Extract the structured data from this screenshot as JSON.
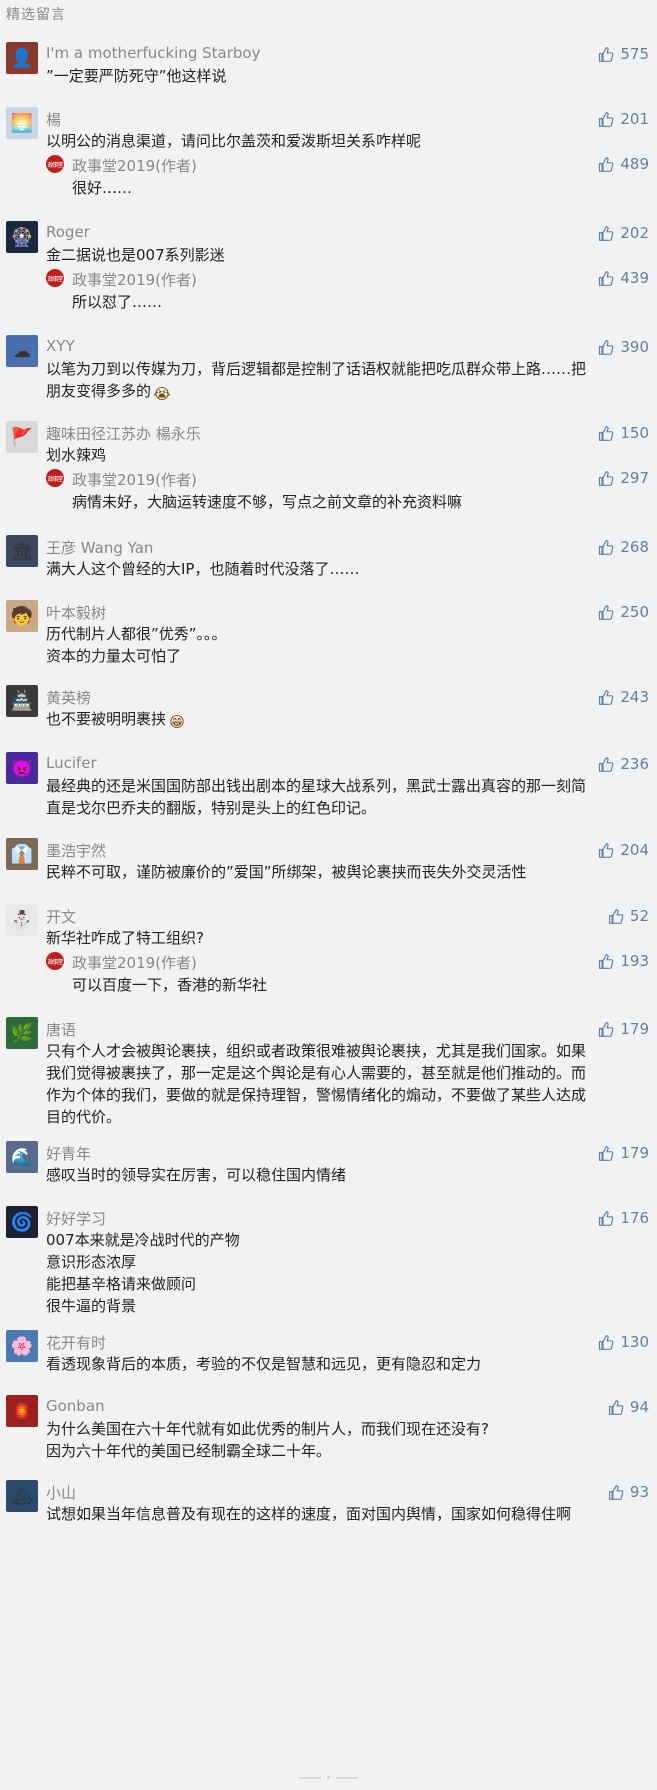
{
  "header": "精选留言",
  "author_badge": "政事堂",
  "comments": [
    {
      "name": "I'm a motherfucking Starboy",
      "likes": "575",
      "lines": [
        "”一定要严防死守”他这样说"
      ]
    },
    {
      "name": "楊",
      "likes": "201",
      "lines": [
        "以明公的消息渠道，请问比尔盖茨和爱泼斯坦关系咋样呢"
      ],
      "reply": {
        "name": "政事堂2019(作者)",
        "likes": "489",
        "lines": [
          "很好……"
        ]
      }
    },
    {
      "name": "Roger",
      "likes": "202",
      "lines": [
        "金二据说也是007系列影迷"
      ],
      "reply": {
        "name": "政事堂2019(作者)",
        "likes": "439",
        "lines": [
          "所以怼了……"
        ]
      }
    },
    {
      "name": "XYY",
      "likes": "390",
      "lines": [
        "以笔为刀到以传媒为刀，背后逻辑都是控制了话语权就能把吃瓜群众带上路……把",
        "朋友变得多多的"
      ],
      "emoji": "😭"
    },
    {
      "name": "趣味田径江苏办 楊永乐",
      "likes": "150",
      "lines": [
        "划水辣鸡"
      ],
      "reply": {
        "name": "政事堂2019(作者)",
        "likes": "297",
        "lines": [
          "病情未好，大脑运转速度不够，写点之前文章的补充资料嘛"
        ]
      }
    },
    {
      "name": "王彦 Wang Yan",
      "likes": "268",
      "lines": [
        "满大人这个曾经的大IP，也随着时代没落了……"
      ]
    },
    {
      "name": "叶本毅树",
      "likes": "250",
      "lines": [
        "历代制片人都很”优秀”。。。",
        "资本的力量太可怕了"
      ]
    },
    {
      "name": "黄英榜",
      "likes": "243",
      "lines": [
        "也不要被明明裹挟"
      ],
      "emoji": "😁"
    },
    {
      "name": "Lucifer",
      "likes": "236",
      "lines": [
        "最经典的还是米国国防部出钱出剧本的星球大战系列，黑武士露出真容的那一刻简",
        "直是戈尔巴乔夫的翻版，特别是头上的红色印记。"
      ]
    },
    {
      "name": "墨浩宇然",
      "likes": "204",
      "lines": [
        "民粹不可取，谨防被廉价的”爱国”所绑架，被舆论裹挟而丧失外交灵活性"
      ]
    },
    {
      "name": "开文",
      "likes": "52",
      "lines": [
        "新华社咋成了特工组织?"
      ],
      "reply": {
        "name": "政事堂2019(作者)",
        "likes": "193",
        "lines": [
          "可以百度一下，香港的新华社"
        ]
      }
    },
    {
      "name": "唐语",
      "likes": "179",
      "lines": [
        "只有个人才会被舆论裹挟，组织或者政策很难被舆论裹挟，尤其是我们国家。如果",
        "我们觉得被裹挟了，那一定是这个舆论是有心人需要的，甚至就是他们推动的。而",
        "作为个体的我们，要做的就是保持理智，警惕情绪化的煽动，不要做了某些人达成",
        "目的代价。"
      ]
    },
    {
      "name": "好青年",
      "likes": "179",
      "lines": [
        "感叹当时的领导实在厉害，可以稳住国内情绪"
      ]
    },
    {
      "name": "好好学习",
      "likes": "176",
      "lines": [
        "007本来就是冷战时代的产物",
        "意识形态浓厚",
        "能把基辛格请来做顾问",
        "很牛逼的背景"
      ]
    },
    {
      "name": "花开有时",
      "likes": "130",
      "lines": [
        "看透现象背后的本质，考验的不仅是智慧和远见，更有隐忍和定力"
      ]
    },
    {
      "name": "Gonban",
      "likes": "94",
      "lines": [
        "为什么美国在六十年代就有如此优秀的制片人，而我们现在还没有?",
        "因为六十年代的美国已经制霸全球二十年。"
      ]
    },
    {
      "name": "小山",
      "likes": "93",
      "lines": [
        "试想如果当年信息普及有现在的这样的速度，面对国内舆情，国家如何稳得住啊"
      ]
    }
  ],
  "avatar_colors": [
    "#8a3a2a",
    "#c9d6e8",
    "#1b2a3a",
    "#4a6fb0",
    "#d9d9d9",
    "#3a4860",
    "#c8a888",
    "#3a3a3a",
    "#4b2aa0",
    "#7a6a5a",
    "#e8e8e8",
    "#2f6a3a",
    "#5a6a8a",
    "#1e2230",
    "#4a7ab0",
    "#a02020",
    "#2a4a6a"
  ],
  "avatar_glyphs": [
    "👤",
    "🌅",
    "🎡",
    "☁",
    "🚩",
    "🏛",
    "🧒",
    "🏯",
    "👿",
    "👔",
    "⛄",
    "🌿",
    "🌊",
    "🌀",
    "🌸",
    "🏮",
    "🏔"
  ]
}
